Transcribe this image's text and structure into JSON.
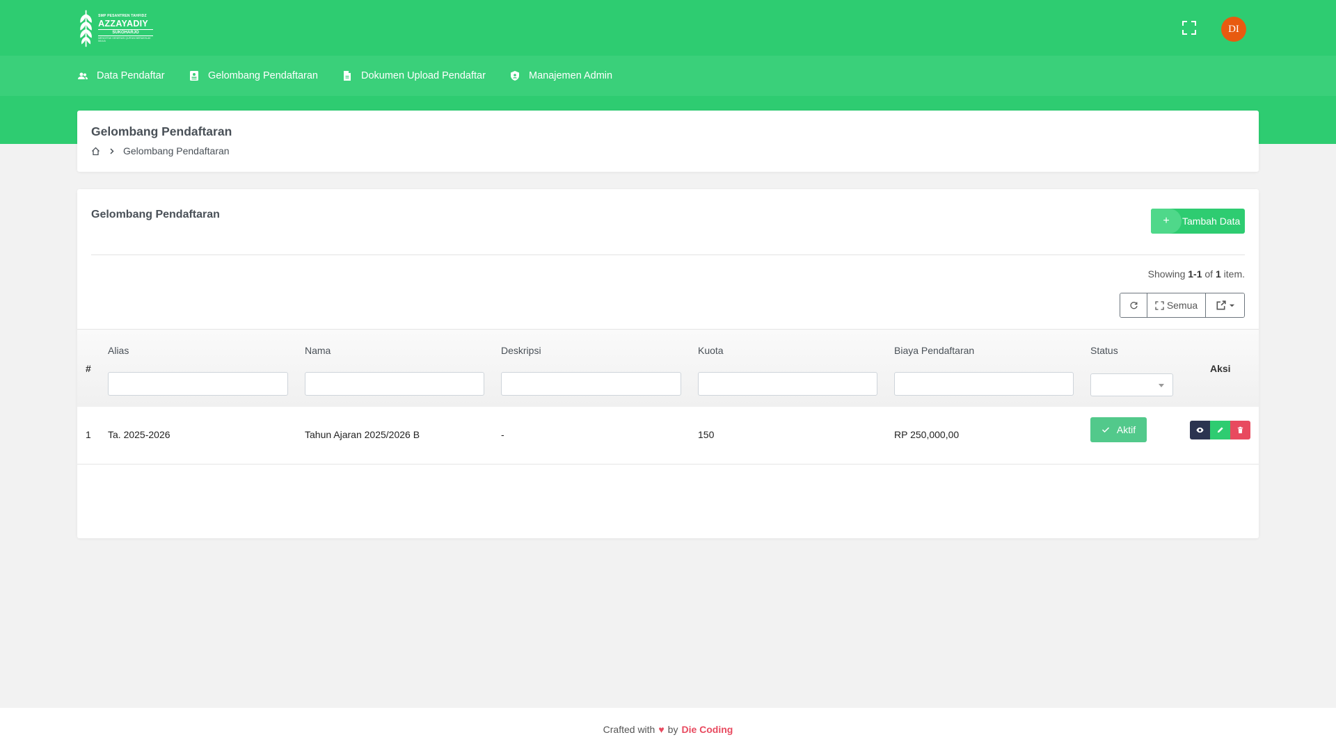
{
  "header": {
    "logo": {
      "small": "SMP PESANTREN TAHFIDZ",
      "name": "AZZAYADIY",
      "city": "SUKOHARJO",
      "tagline": "MENCETAK GENERASI QUR'ANI BERAKHLAK MULIA"
    },
    "avatar_initials": "DI"
  },
  "nav": {
    "items": [
      {
        "label": "Data Pendaftar",
        "icon": "users-icon"
      },
      {
        "label": "Gelombang Pendaftaran",
        "icon": "id-card-icon"
      },
      {
        "label": "Dokumen Upload Pendaftar",
        "icon": "file-icon"
      },
      {
        "label": "Manajemen Admin",
        "icon": "shield-icon"
      }
    ]
  },
  "page": {
    "title": "Gelombang Pendaftaran",
    "breadcrumb_current": "Gelombang Pendaftaran"
  },
  "card": {
    "title": "Gelombang Pendaftaran",
    "add_button": "Tambah Data",
    "summary": {
      "prefix": "Showing",
      "range": "1-1",
      "of": "of",
      "total": "1",
      "suffix": "item."
    },
    "toolbar": {
      "all_label": "Semua"
    }
  },
  "table": {
    "columns": {
      "hash": "#",
      "alias": "Alias",
      "nama": "Nama",
      "deskripsi": "Deskripsi",
      "kuota": "Kuota",
      "biaya": "Biaya Pendaftaran",
      "status": "Status",
      "aksi": "Aksi"
    },
    "rows": [
      {
        "no": "1",
        "alias": "Ta. 2025-2026",
        "nama": "Tahun Ajaran 2025/2026 B",
        "deskripsi": "-",
        "kuota": "150",
        "biaya": "RP 250,000,00",
        "status": "Aktif"
      }
    ]
  },
  "footer": {
    "prefix": "Crafted with",
    "heart": "♥",
    "by": "by",
    "brand": "Die Coding"
  },
  "colors": {
    "primary_green": "#2ecc71",
    "nav_green": "#3ad07a",
    "avatar": "#e85a10",
    "danger": "#e84a5f",
    "dark": "#2b3450"
  }
}
